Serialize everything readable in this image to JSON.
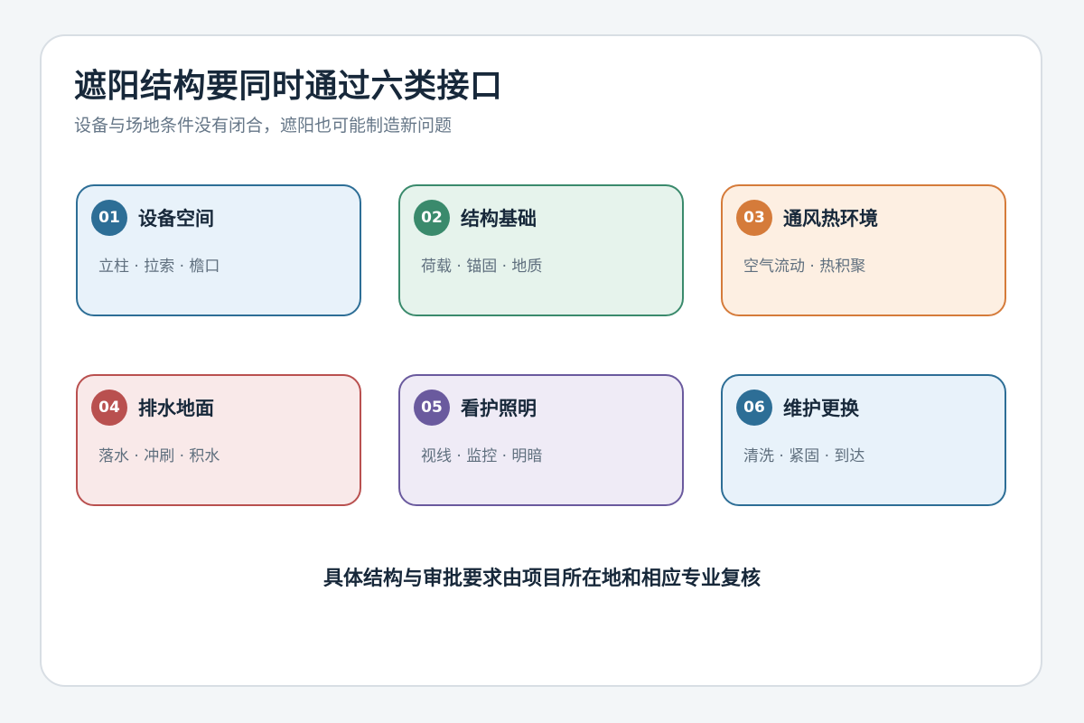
{
  "title": "遮阳结构要同时通过六类接口",
  "subtitle": "设备与场地条件没有闭合，遮阳也可能制造新问题",
  "cards": [
    {
      "num": "01",
      "name": "设备空间",
      "items": "立柱 · 拉索 · 檐口",
      "accent": "#2d6e96",
      "fill": "#e8f2fa"
    },
    {
      "num": "02",
      "name": "结构基础",
      "items": "荷载 · 锚固 · 地质",
      "accent": "#3a8a6c",
      "fill": "#e6f3ec"
    },
    {
      "num": "03",
      "name": "通风热环境",
      "items": "空气流动 · 热积聚",
      "accent": "#d57b3a",
      "fill": "#fdefe2"
    },
    {
      "num": "04",
      "name": "排水地面",
      "items": "落水 · 冲刷 · 积水",
      "accent": "#b9504f",
      "fill": "#f9e9e9"
    },
    {
      "num": "05",
      "name": "看护照明",
      "items": "视线 · 监控 · 明暗",
      "accent": "#6a5a9e",
      "fill": "#efebf6"
    },
    {
      "num": "06",
      "name": "维护更换",
      "items": "清洗 · 紧固 · 到达",
      "accent": "#2d6e96",
      "fill": "#e8f2fa"
    }
  ],
  "footer": "具体结构与审批要求由项目所在地和相应专业复核"
}
